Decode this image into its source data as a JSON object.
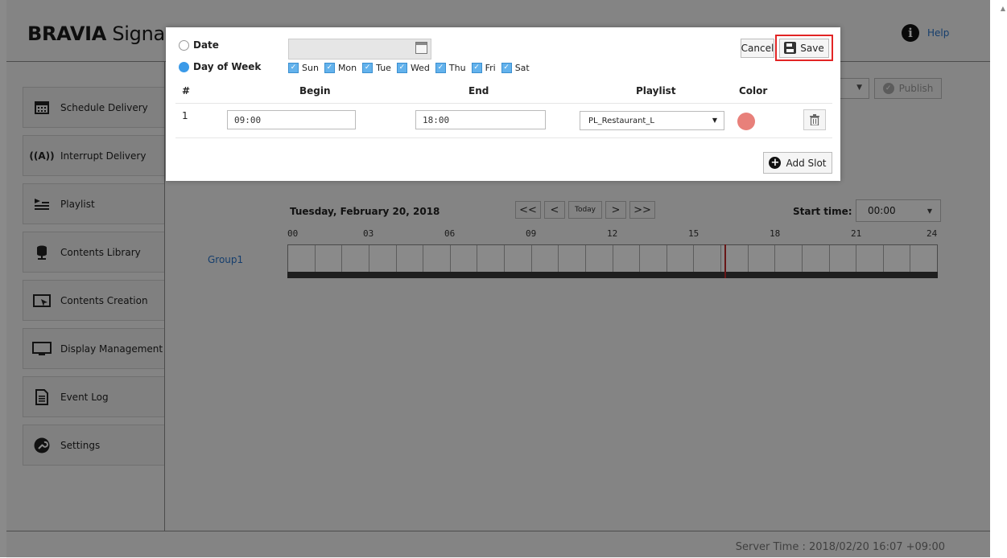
{
  "app": {
    "brand_bold": "BRAVIA",
    "brand_rest": " Signage",
    "help_label": "Help",
    "server_time": "Server Time : 2018/02/20 16:07 +09:00"
  },
  "sidebar": {
    "items": [
      {
        "label": "Schedule Delivery",
        "icon": "calendar-icon"
      },
      {
        "label": "Interrupt Delivery",
        "icon": "broadcast-icon"
      },
      {
        "label": "Playlist",
        "icon": "playlist-icon"
      },
      {
        "label": "Contents Library",
        "icon": "database-icon"
      },
      {
        "label": "Contents Creation",
        "icon": "content-create-icon"
      },
      {
        "label": "Display Management",
        "icon": "monitor-icon"
      },
      {
        "label": "Event Log",
        "icon": "document-icon"
      },
      {
        "label": "Settings",
        "icon": "wrench-icon"
      }
    ]
  },
  "toolbar": {
    "publish_label": "Publish"
  },
  "timeline": {
    "date": "Tuesday, February 20, 2018",
    "nav": {
      "first": "<<",
      "prev": "<",
      "today": "Today",
      "next": ">",
      "last": ">>"
    },
    "start_time_label": "Start time:",
    "start_time_value": "00:00",
    "ticks": [
      "00",
      "03",
      "06",
      "09",
      "12",
      "15",
      "18",
      "21",
      "24"
    ],
    "group_label": "Group1",
    "current_hour": 16.12
  },
  "modal": {
    "date_label": "Date",
    "day_of_week_label": "Day of Week",
    "mode": "day_of_week",
    "days": [
      "Sun",
      "Mon",
      "Tue",
      "Wed",
      "Thu",
      "Fri",
      "Sat"
    ],
    "days_checked": [
      true,
      true,
      true,
      true,
      true,
      true,
      true
    ],
    "cancel_label": "Cancel",
    "save_label": "Save",
    "columns": {
      "num": "#",
      "begin": "Begin",
      "end": "End",
      "playlist": "Playlist",
      "color": "Color"
    },
    "slots": [
      {
        "num": "1",
        "begin": "09:00",
        "end": "18:00",
        "playlist": "PL_Restaurant_L",
        "color": "#e8807a"
      }
    ],
    "add_slot_label": "Add Slot"
  },
  "colors": {
    "highlight": "#e22525",
    "link": "#2a74c9",
    "now_line": "#c0292c"
  }
}
